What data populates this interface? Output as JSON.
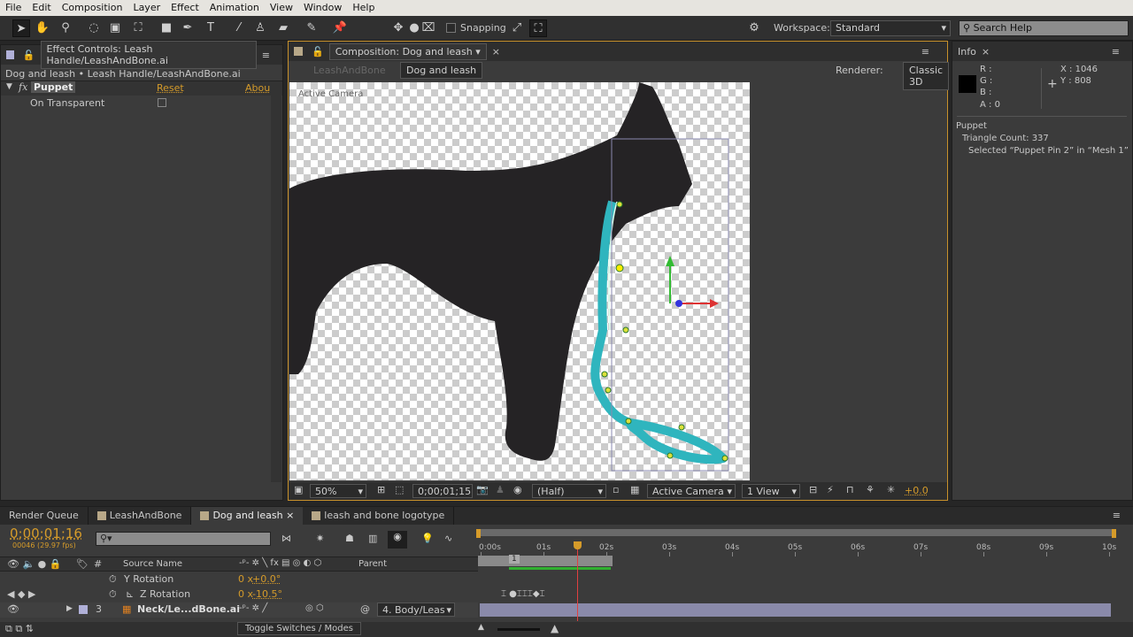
{
  "menu": [
    "File",
    "Edit",
    "Composition",
    "Layer",
    "Effect",
    "Animation",
    "View",
    "Window",
    "Help"
  ],
  "toolbar": {
    "snapping_label": "Snapping",
    "workspace_label": "Workspace:",
    "workspace_value": "Standard",
    "search_placeholder": "Search Help"
  },
  "effect_controls": {
    "tab": "Effect Controls: Leash Handle/LeashAndBone.ai",
    "breadcrumb": "Dog and leash • Leash Handle/LeashAndBone.ai",
    "effect_name": "Puppet",
    "reset": "Reset",
    "about": "Abou",
    "property": "On Transparent",
    "on_transparent_checked": false
  },
  "composition": {
    "tab": "Composition: Dog and leash",
    "crumbs": [
      "LeashAndBone",
      "Dog and leash"
    ],
    "renderer_label": "Renderer:",
    "renderer_value": "Classic 3D",
    "camera_label": "Active Camera",
    "footer": {
      "zoom": "50%",
      "timecode": "0;00;01;15",
      "resolution": "(Half)",
      "camera": "Active Camera",
      "views": "1 View",
      "exposure": "+0.0"
    }
  },
  "info": {
    "tab": "Info",
    "r": "R :",
    "g": "G :",
    "b": "B :",
    "a": "A :  0",
    "x": "X : 1046",
    "y": "Y : 808",
    "section": "Puppet",
    "triangle_count": "Triangle Count: 337",
    "selected": "Selected “Puppet Pin 2” in “Mesh 1”",
    "color_swatch": "#000000"
  },
  "timeline": {
    "tabs": [
      "Render Queue",
      "LeashAndBone",
      "Dog and leash",
      "leash and bone logotype"
    ],
    "active_tab": 2,
    "timecode": "0;00;01;16",
    "frame_info": "00046 (29.97 fps)",
    "columns": {
      "num": "#",
      "source": "Source Name",
      "parent": "Parent"
    },
    "rows": [
      {
        "name": "Y Rotation",
        "value_rev": "0 x",
        "value": "+0.0°"
      },
      {
        "name": "Z Rotation",
        "value_rev": "0 x",
        "value": "-10.5°"
      }
    ],
    "layer": {
      "num": "3",
      "name": "Neck/Le...dBone.ai",
      "parent": "4. Body/Leas"
    },
    "ruler": [
      "0:00s",
      "01s",
      "02s",
      "03s",
      "04s",
      "05s",
      "06s",
      "07s",
      "08s",
      "09s",
      "10s"
    ],
    "work_area_marker": "1",
    "playhead_seconds": 1.53,
    "toggle_label": "Toggle Switches / Modes"
  },
  "colors": {
    "accent": "#d59b2a",
    "leash": "#2fb5be",
    "layer_bar": "#8a8aaa",
    "playhead": "#e04040"
  }
}
